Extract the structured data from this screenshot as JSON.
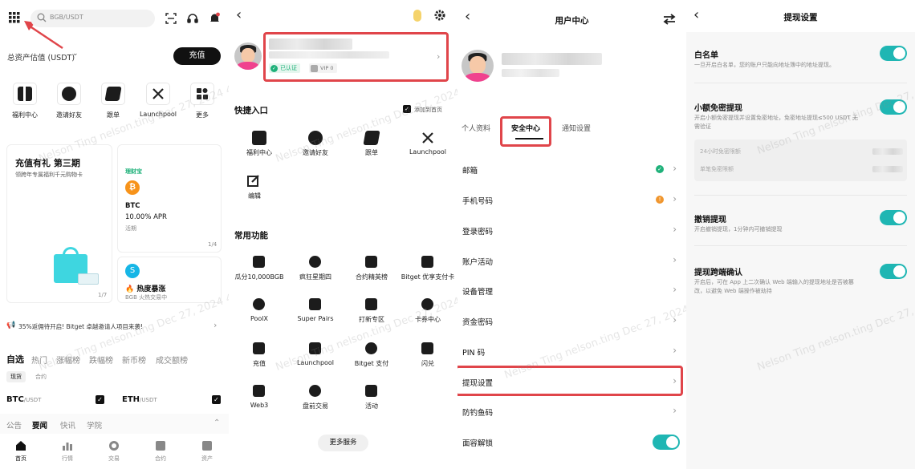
{
  "watermark": "Nelson Ting nelson.ting Dec 27, 2024 4:59 PM",
  "p1": {
    "search_placeholder": "BGB/USDT",
    "asset_label": "总资产估值 (USDT)",
    "deposit_btn": "充值",
    "quick": [
      "福利中心",
      "邀请好友",
      "跟单",
      "Launchpool",
      "更多"
    ],
    "promo_title": "充值有礼 第三期",
    "promo_sub": "领跨年专属福利千元购物卡",
    "promo_page": "1/7",
    "licai": "理财宝",
    "btc": "BTC",
    "apr": "10.00% APR",
    "huoqi": "活期",
    "card_page": "1/4",
    "hot": "🔥 热度暴涨",
    "hot_sub": "BGB 火热交易中",
    "notice": "35%返佣待开启! Bitget 卓越邀请人项目来袭!",
    "tabs": [
      "自选",
      "热门",
      "涨幅榜",
      "跌幅榜",
      "新币榜",
      "成交额榜"
    ],
    "subtabs": [
      "现货",
      "合约"
    ],
    "pair1": "BTC",
    "pair1_quote": "/USDT",
    "pair2": "ETH",
    "pair2_quote": "/USDT",
    "newstabs": [
      "公告",
      "要闻",
      "快讯",
      "学院"
    ],
    "nav": [
      "首页",
      "行情",
      "交易",
      "合约",
      "资产"
    ]
  },
  "p2": {
    "verified": "已认证",
    "vip": "VIP 0",
    "quick_title": "快捷入口",
    "add_home": "添加到首页",
    "quick": [
      "福利中心",
      "邀请好友",
      "跟单",
      "Launchpool",
      "编辑"
    ],
    "common_title": "常用功能",
    "common": [
      "瓜分10,000BGB",
      "疯狂星期四",
      "合约精英榜",
      "Bitget 优享支付卡",
      "PoolX",
      "Super Pairs",
      "打新专区",
      "卡券中心",
      "充值",
      "Launchpool",
      "Bitget 支付",
      "闪兑",
      "Web3",
      "盘前交易",
      "活动"
    ],
    "more_btn": "更多服务"
  },
  "p3": {
    "title": "用户中心",
    "tabs": [
      "个人资料",
      "安全中心",
      "通知设置"
    ],
    "rows": [
      "邮箱",
      "手机号码",
      "登录密码",
      "账户活动",
      "设备管理",
      "资金密码",
      "PIN 码",
      "提现设置",
      "防钓鱼码",
      "面容解锁"
    ]
  },
  "p4": {
    "title": "提现设置",
    "whitelist": "白名单",
    "whitelist_desc": "一旦开启白名单，您的账户只能向地址簿中的地址提现。",
    "small": "小额免密提现",
    "small_desc": "开启小额免密提现并设置免密地址，免密地址提现≤500 USDT 无需验证",
    "limit_24h": "24小时免密限额",
    "limit_single": "单笔免密限额",
    "cancel": "撤销提现",
    "cancel_desc": "开启撤销提现，1分钟内可撤销提现",
    "cross": "提现跨端确认",
    "cross_desc": "开启后，可在 App 上二次确认 Web 端输入的提现地址是否被篡改，以避免 Web 端操作被劫持"
  },
  "colors": {
    "accent": "#1fb6b3",
    "highlight": "#e0454a",
    "verified": "#1fb17a"
  }
}
